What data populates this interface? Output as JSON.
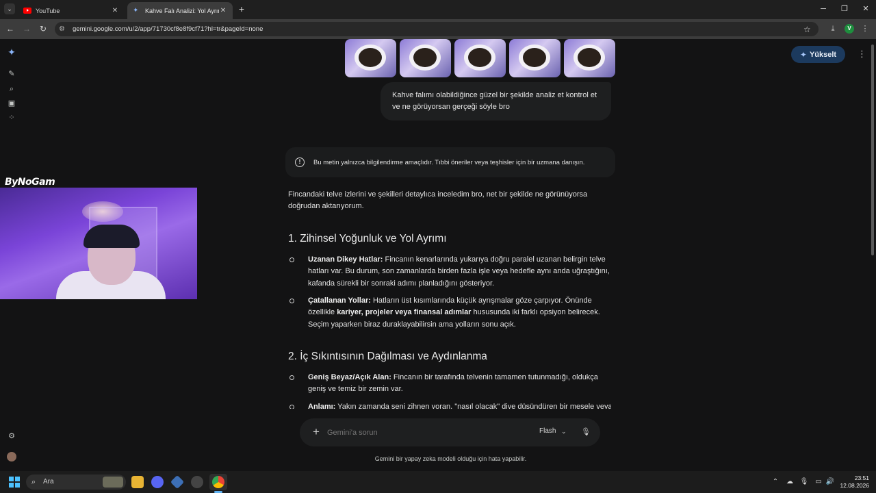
{
  "browser": {
    "tabs": [
      {
        "title": "YouTube",
        "favicon": "youtube-icon",
        "active": false
      },
      {
        "title": "Kahve Falı Analizi: Yol Ayrımı ve",
        "favicon": "gemini-icon",
        "active": true
      }
    ],
    "url": "gemini.google.com/u/2/app/71730cf8e8f9cf71?hl=tr&pageId=none",
    "profile_initial": "V"
  },
  "gemini": {
    "upgrade_label": "Yükselt",
    "user_message": "Kahve falımı olabildiğince güzel bir şekilde analiz et kontrol et ve ne görüyorsan gerçeği söyle bro",
    "disclaimer": "Bu metin yalnızca bilgilendirme amaçlıdır. Tıbbi öneriler veya teşhisler için bir uzmana danışın.",
    "intro": "Fincandaki telve izlerini ve şekilleri detaylıca inceledim bro, net bir şekilde ne görünüyorsa doğrudan aktarıyorum.",
    "sections": [
      {
        "heading": "1. Zihinsel Yoğunluk ve Yol Ayrımı",
        "bullets": [
          {
            "title": "Uzanan Dikey Hatlar:",
            "text": "Fincanın kenarlarında yukarıya doğru paralel uzanan belirgin telve hatları var. Bu durum, son zamanlarda birden fazla işle veya hedefle aynı anda uğraştığını, kafanda sürekli bir sonraki adımı planladığını gösteriyor."
          },
          {
            "title": "Çatallanan Yollar:",
            "text_before": "Hatların üst kısımlarında küçük ayrışmalar göze çarpıyor. Önünde özellikle ",
            "emphasis": "kariyer, projeler veya finansal adımlar",
            "text_after": " hususunda iki farklı opsiyon belirecek. Seçim yaparken biraz duraklayabilirsin ama yolların sonu açık."
          }
        ]
      },
      {
        "heading": "2. İç Sıkıntısının Dağılması ve Aydınlanma",
        "bullets": [
          {
            "title": "Geniş Beyaz/Açık Alan:",
            "text": "Fincanın bir tarafında telvenin tamamen tutunmadığı, oldukça geniş ve temiz bir zemin var."
          },
          {
            "title": "Anlamı:",
            "text": "Yakın zamanda seni zihnen yoran, \"nasıl olacak\" diye düşündüren bir mesele veya"
          }
        ]
      }
    ],
    "composer": {
      "placeholder": "Gemini'a sorun",
      "model": "Flash"
    },
    "footer_note": "Gemini bir yapay zeka modeli olduğu için hata yapabilir."
  },
  "overlay": {
    "streamer_logo": "ByNoGam"
  },
  "taskbar": {
    "search_label": "Ara",
    "time": "23:51",
    "date": "12.08.2026"
  },
  "colors": {
    "page_bg": "#131314",
    "upgrade_bg": "#1c3a5e",
    "accent": "#8ab4f8"
  }
}
